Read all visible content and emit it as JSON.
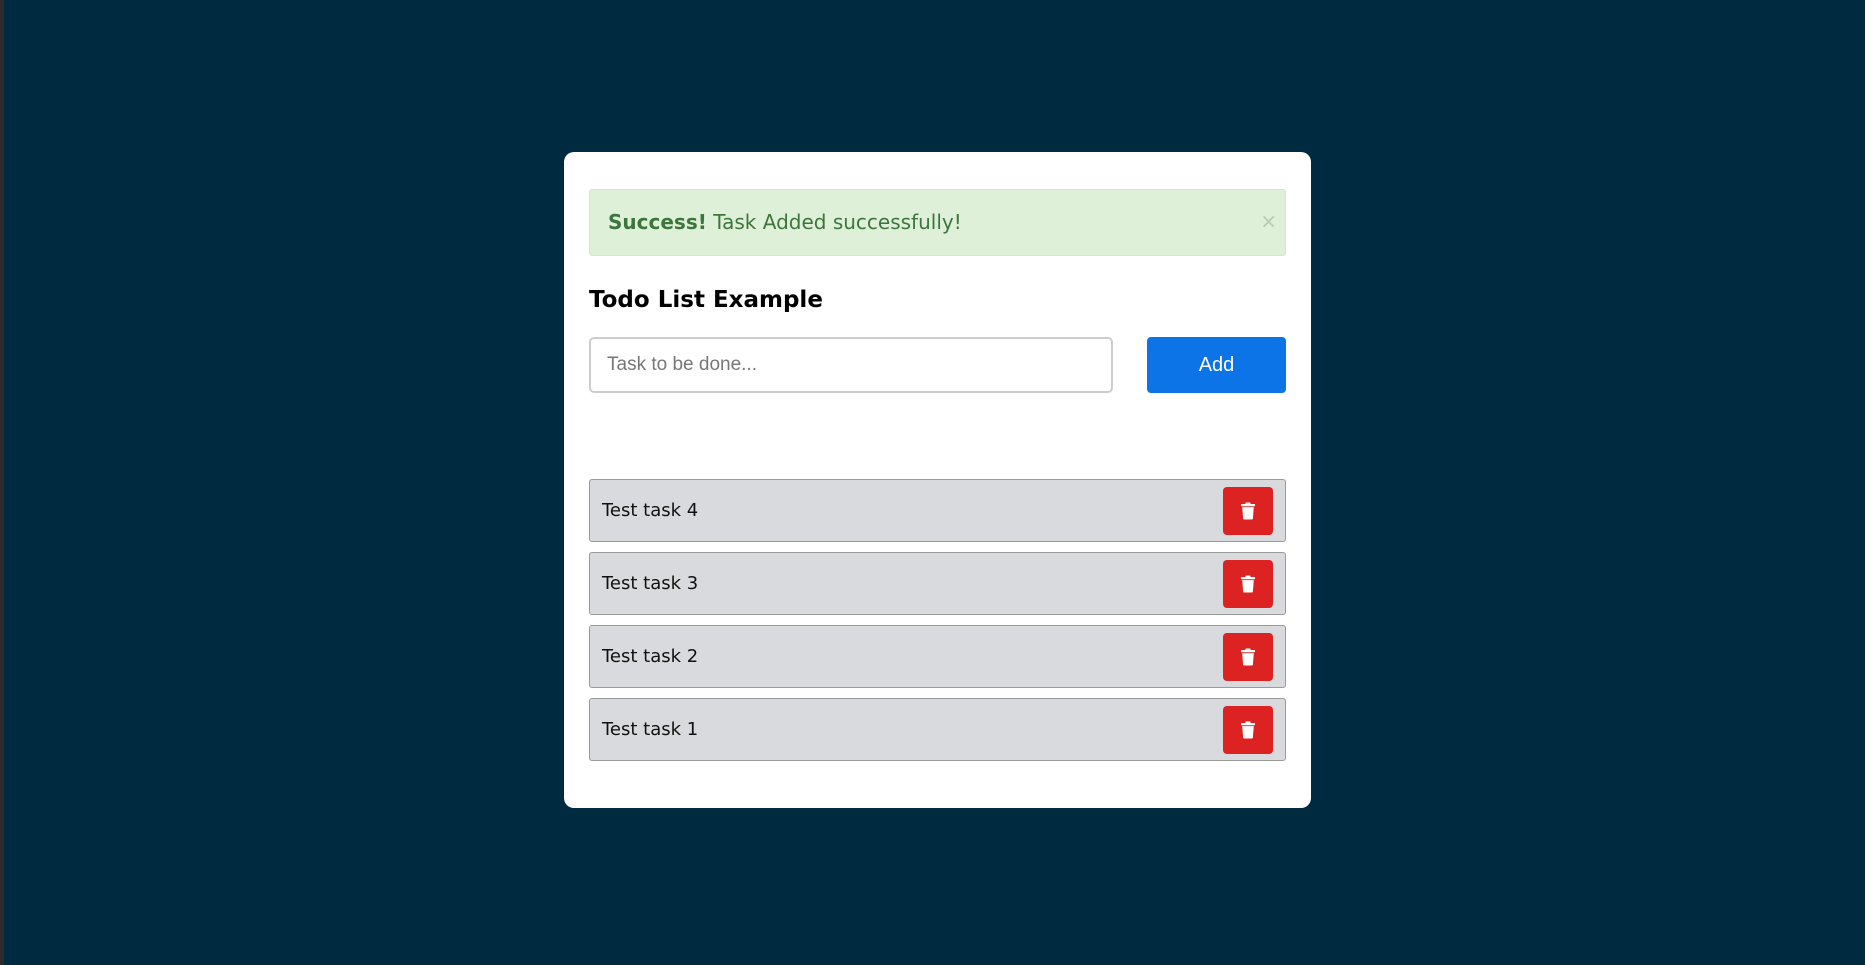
{
  "alert": {
    "strong": "Success!",
    "message": " Task Added successfully!",
    "close": "×"
  },
  "title": "Todo List Example",
  "input": {
    "placeholder": "Task to be done...",
    "value": ""
  },
  "add_button": "Add",
  "tasks": [
    {
      "label": "Test task 4",
      "icon": "trash-icon"
    },
    {
      "label": "Test task 3",
      "icon": "trash-icon"
    },
    {
      "label": "Test task 2",
      "icon": "trash-icon"
    },
    {
      "label": "Test task 1",
      "icon": "trash-icon"
    }
  ],
  "colors": {
    "background": "#002a40",
    "card": "#ffffff",
    "alert_bg": "#dff0d8",
    "alert_text": "#3c763d",
    "add_button": "#0d74e8",
    "delete_button": "#dd2222",
    "task_bg": "#d9dadd"
  }
}
